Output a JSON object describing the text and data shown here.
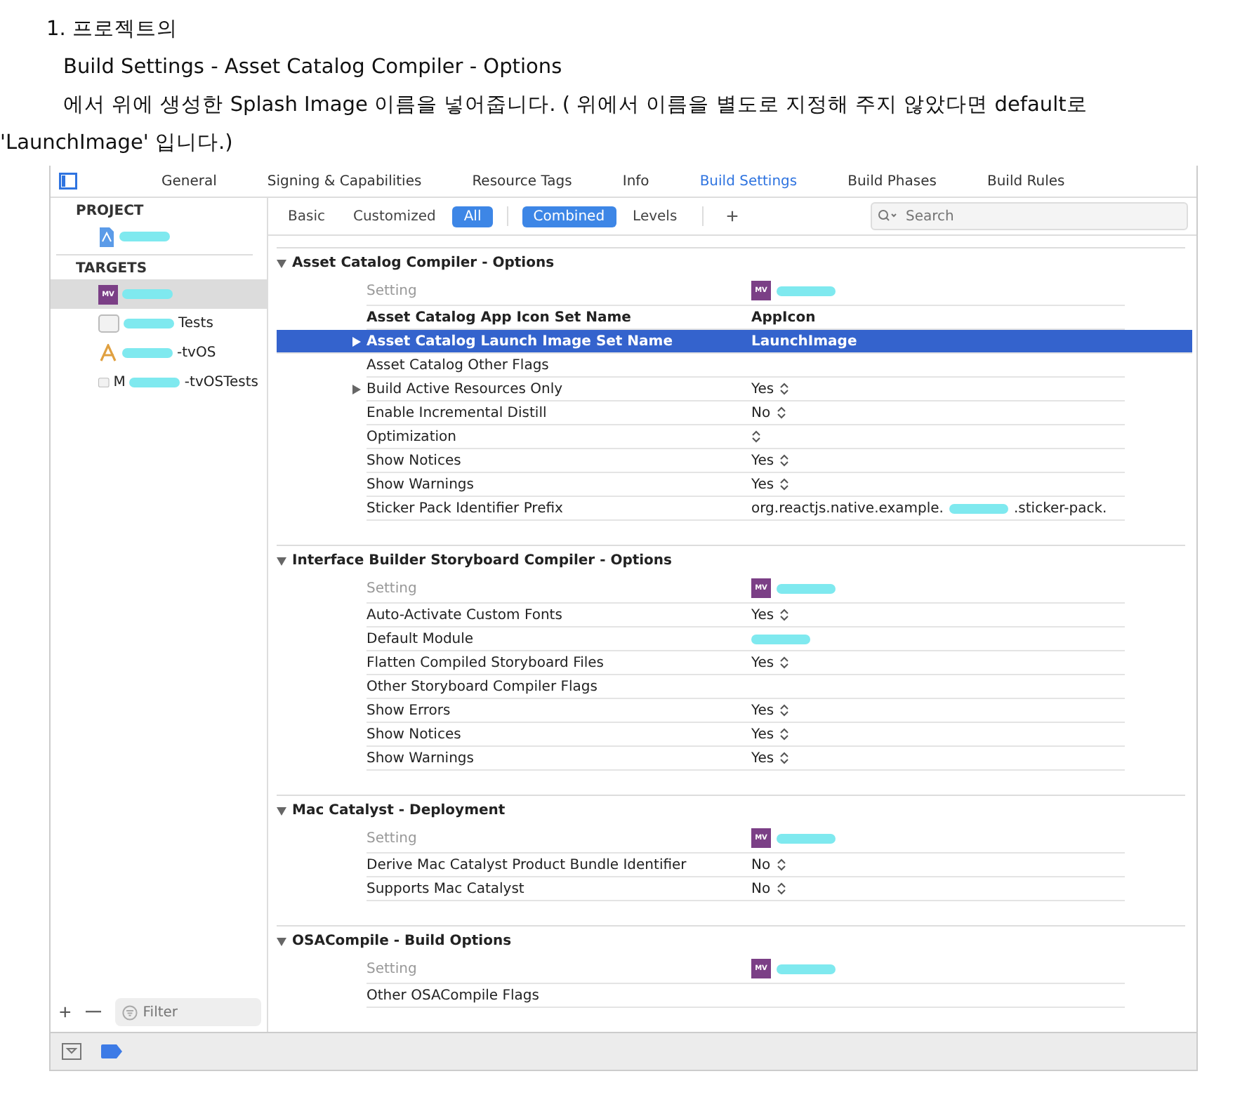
{
  "intro": [
    "1.  프로젝트의",
    "Build Settings - Asset Catalog Compiler - Options",
    "에서 위에 생성한 Splash Image 이름을 넣어줍니다. ( 위에서 이름을 별도로 지정해 주지 않았다면 default로",
    "'LaunchImage' 입니다.)"
  ],
  "tabs": [
    {
      "label": "General",
      "selected": false
    },
    {
      "label": "Signing & Capabilities",
      "selected": false
    },
    {
      "label": "Resource Tags",
      "selected": false
    },
    {
      "label": "Info",
      "selected": false
    },
    {
      "label": "Build Settings",
      "selected": true
    },
    {
      "label": "Build Phases",
      "selected": false
    },
    {
      "label": "Build Rules",
      "selected": false
    }
  ],
  "sidebar": {
    "sections": [
      {
        "title": "PROJECT",
        "items": [
          {
            "kind": "project",
            "redacted": true,
            "selected": false
          }
        ]
      },
      {
        "title": "TARGETS",
        "items": [
          {
            "kind": "app",
            "badge": "MV",
            "redacted": true,
            "selected": true
          },
          {
            "kind": "tests",
            "label": "Tests",
            "redacted": true,
            "selected": false
          },
          {
            "kind": "tvos",
            "label": "-tvOS",
            "redacted": true,
            "selected": false
          },
          {
            "kind": "tests",
            "prefix": "M",
            "label": "-tvOSTests",
            "redacted": true,
            "selected": false
          }
        ]
      }
    ],
    "filter_placeholder": "Filter"
  },
  "filters": [
    {
      "label": "Basic",
      "selected": false
    },
    {
      "label": "Customized",
      "selected": false
    },
    {
      "label": "All",
      "selected": true
    }
  ],
  "views": [
    {
      "label": "Combined",
      "selected": true
    },
    {
      "label": "Levels",
      "selected": false
    }
  ],
  "add_label": "+",
  "search": {
    "placeholder": "Search"
  },
  "sections": [
    {
      "title": "Asset Catalog Compiler - Options",
      "column": "Setting",
      "badge": "MV",
      "rows": [
        {
          "name": "Asset Catalog App Icon Set Name",
          "value": "AppIcon",
          "bold": true,
          "selected": false
        },
        {
          "name": "Asset Catalog Launch Image Set Name",
          "value": "LaunchImage",
          "bold": true,
          "selected": true,
          "expandable": true
        },
        {
          "name": "Asset Catalog Other Flags",
          "selected": false
        },
        {
          "name": "Build Active Resources Only",
          "value": "Yes",
          "popup": true,
          "selected": false,
          "expandable": true
        },
        {
          "name": "Enable Incremental Distill",
          "value": "No",
          "popup": true,
          "selected": false
        },
        {
          "name": "Optimization",
          "popup": true,
          "selected": false
        },
        {
          "name": "Show Notices",
          "value": "Yes",
          "popup": true,
          "selected": false
        },
        {
          "name": "Show Warnings",
          "value": "Yes",
          "popup": true,
          "selected": false
        },
        {
          "name": "Sticker Pack Identifier Prefix",
          "value": "org.reactjs.native.example.",
          "redacted": true,
          "value_end": ".sticker-pack.",
          "selected": false
        }
      ]
    },
    {
      "title": "Interface Builder Storyboard Compiler - Options",
      "column": "Setting",
      "badge": "MV",
      "rows": [
        {
          "name": "Auto-Activate Custom Fonts",
          "value": "Yes",
          "popup": true,
          "selected": false
        },
        {
          "name": "Default Module",
          "redacted": true,
          "selected": false
        },
        {
          "name": "Flatten Compiled Storyboard Files",
          "value": "Yes",
          "popup": true,
          "selected": false
        },
        {
          "name": "Other Storyboard Compiler Flags",
          "selected": false
        },
        {
          "name": "Show Errors",
          "value": "Yes",
          "popup": true,
          "selected": false
        },
        {
          "name": "Show Notices",
          "value": "Yes",
          "popup": true,
          "selected": false
        },
        {
          "name": "Show Warnings",
          "value": "Yes",
          "popup": true,
          "selected": false
        }
      ]
    },
    {
      "title": "Mac Catalyst - Deployment",
      "column": "Setting",
      "badge": "MV",
      "rows": [
        {
          "name": "Derive Mac Catalyst Product Bundle Identifier",
          "value": "No",
          "popup": true,
          "selected": false
        },
        {
          "name": "Supports Mac Catalyst",
          "value": "No",
          "popup": true,
          "selected": false
        }
      ]
    },
    {
      "title": "OSACompile - Build Options",
      "column": "Setting",
      "badge": "MV",
      "rows": [
        {
          "name": "Other OSACompile Flags",
          "selected": false
        }
      ]
    }
  ]
}
